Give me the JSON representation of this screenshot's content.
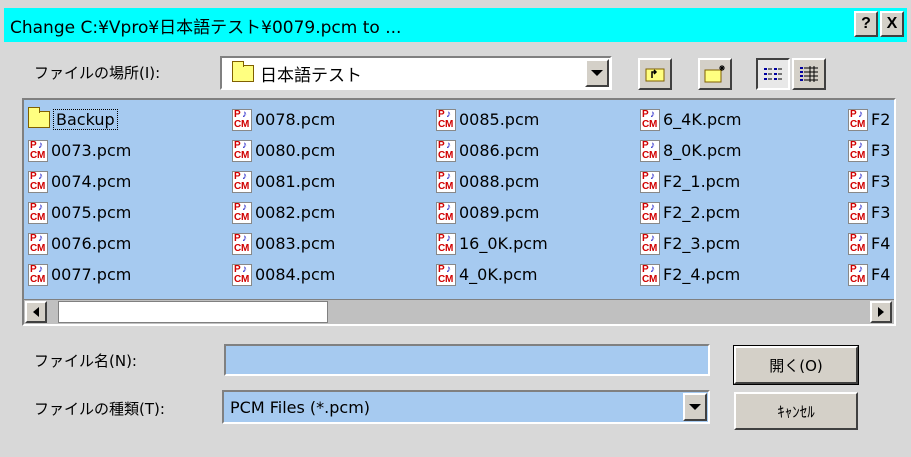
{
  "title": "Change C:¥Vpro¥日本語テスト¥0079.pcm to ...",
  "title_buttons": {
    "help": "?",
    "close": "X"
  },
  "lookin": {
    "label": "ファイルの場所(I):",
    "folder": "日本語テスト"
  },
  "files": [
    [
      "Backup",
      "0073.pcm",
      "0074.pcm",
      "0075.pcm",
      "0076.pcm",
      "0077.pcm"
    ],
    [
      "0078.pcm",
      "0080.pcm",
      "0081.pcm",
      "0082.pcm",
      "0083.pcm",
      "0084.pcm"
    ],
    [
      "0085.pcm",
      "0086.pcm",
      "0088.pcm",
      "0089.pcm",
      "16_0K.pcm",
      "4_0K.pcm"
    ],
    [
      "6_4K.pcm",
      "8_0K.pcm",
      "F2_1.pcm",
      "F2_2.pcm",
      "F2_3.pcm",
      "F2_4.pcm"
    ],
    [
      "F2",
      "F3",
      "F3",
      "F3",
      "F4",
      "F4"
    ]
  ],
  "filename": {
    "label": "ファイル名(N):",
    "value": ""
  },
  "filetype": {
    "label": "ファイルの種類(T):",
    "value": "PCM Files (*.pcm)"
  },
  "buttons": {
    "open": "開く(O)",
    "cancel": "ｷｬﾝｾﾙ"
  }
}
